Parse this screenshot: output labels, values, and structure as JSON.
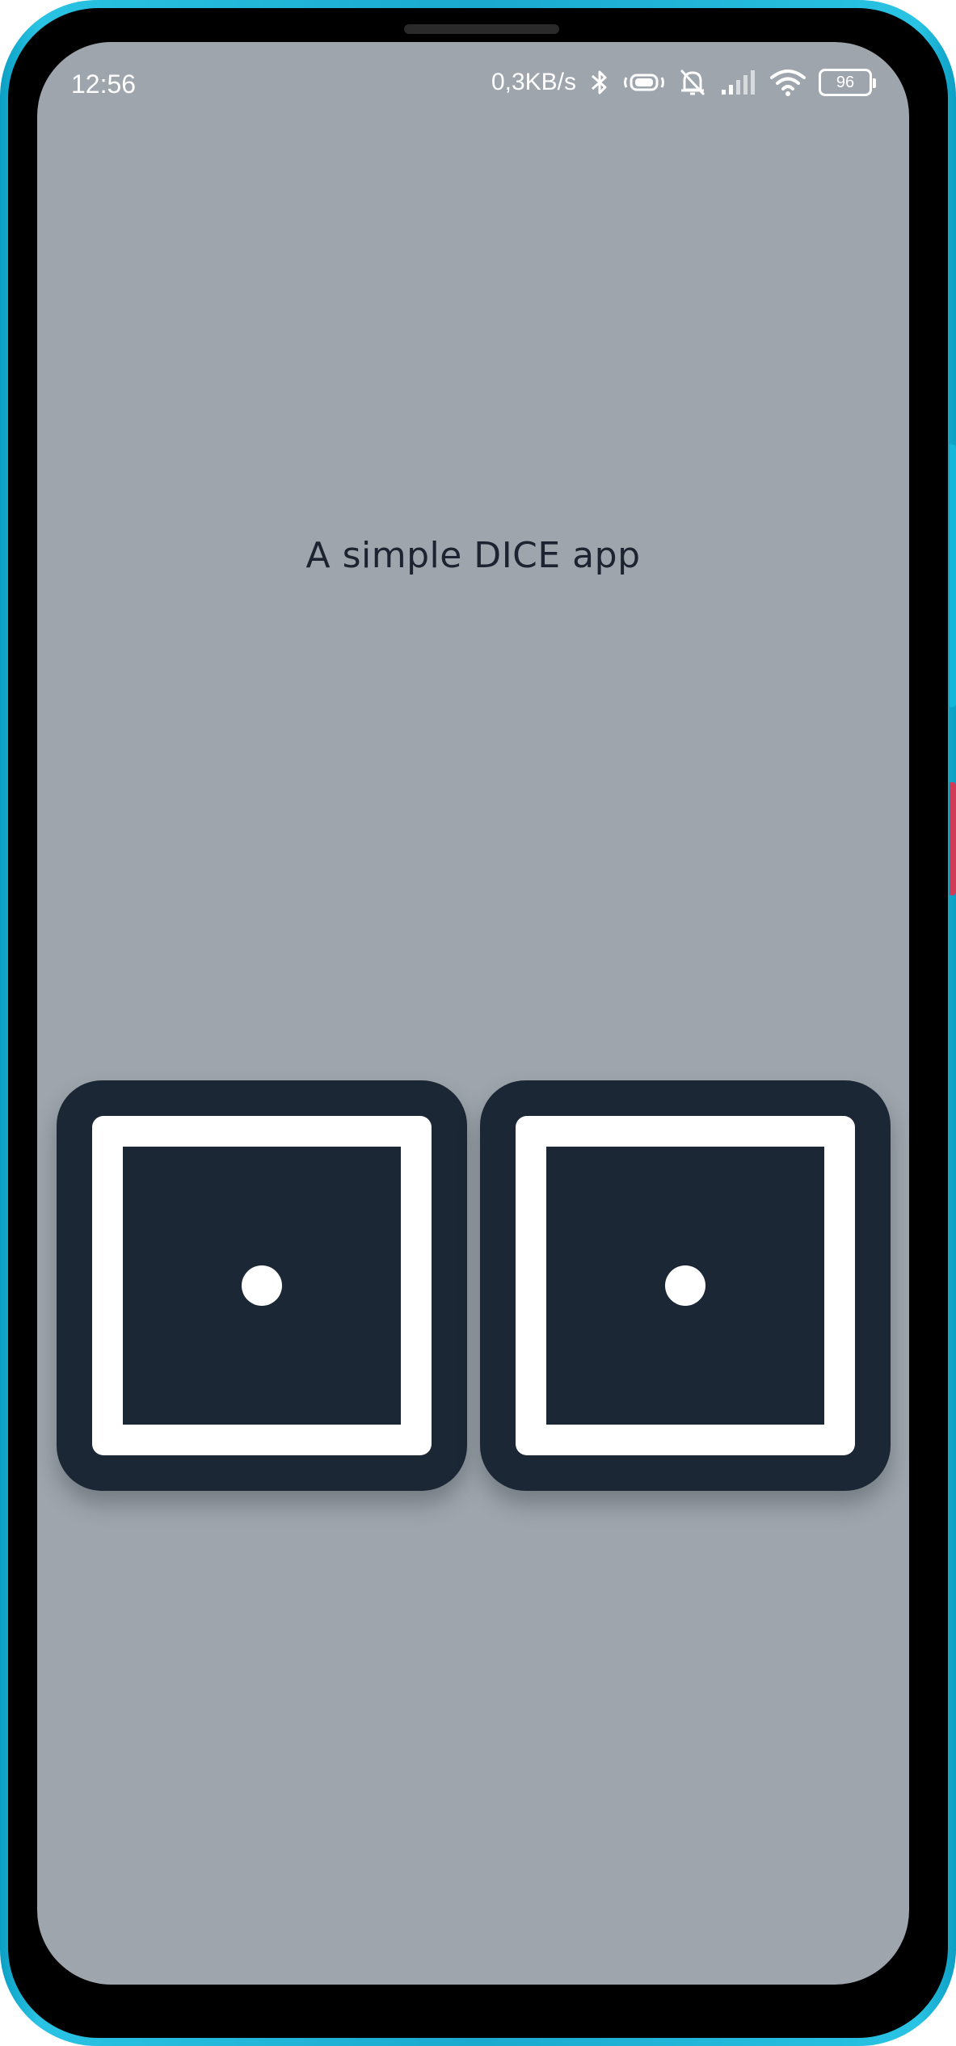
{
  "status_bar": {
    "time": "12:56",
    "network_speed": "0,3KB/s",
    "battery_level": "96",
    "icons": [
      "bluetooth-icon",
      "vibrate-icon",
      "mute-icon",
      "signal-icon",
      "wifi-icon",
      "battery-icon"
    ]
  },
  "app": {
    "title": "A simple DICE app",
    "background_color": "#9ea5ac",
    "die_color": "#1b2734"
  },
  "dice": [
    {
      "label": "die-1",
      "value": 1
    },
    {
      "label": "die-2",
      "value": 1
    }
  ]
}
